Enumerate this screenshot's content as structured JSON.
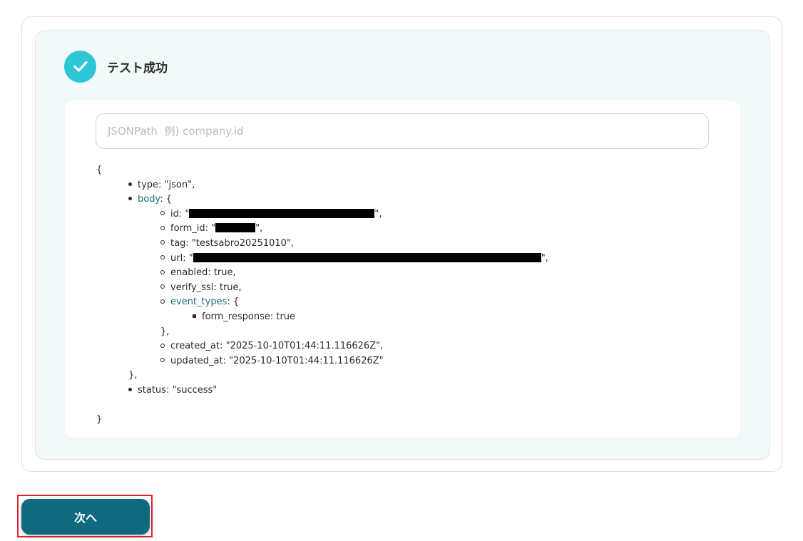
{
  "status": {
    "icon": "check-icon",
    "text": "テスト成功",
    "color": "#2ec5d6"
  },
  "search": {
    "placeholder": "JSONPath  例) company.id",
    "value": ""
  },
  "json": {
    "open_brace": "{",
    "type_line": "type: \"json\",",
    "body_key": "body",
    "body_open": ": {",
    "id_prefix": "id: \"",
    "id_suffix": "\",",
    "form_id_prefix": "form_id: \"",
    "form_id_suffix": "\",",
    "tag_line": "tag: \"testsabro20251010\",",
    "url_prefix": "url: \"",
    "url_suffix": "\",",
    "enabled_line": "enabled: true,",
    "verify_ssl_line": "verify_ssl: true,",
    "event_types_key": "event_types",
    "event_types_open": ": {",
    "form_response_line": "form_response: true",
    "event_types_close": "},",
    "created_at_line": "created_at: \"2025-10-10T01:44:11.116626Z\",",
    "updated_at_line": "updated_at: \"2025-10-10T01:44:11.116626Z\"",
    "body_close": "},",
    "status_line": "status: \"success\"",
    "close_brace": "}"
  },
  "actions": {
    "next_label": "次へ",
    "button_color": "#0f6a80",
    "highlight_color": "#e0242c"
  }
}
